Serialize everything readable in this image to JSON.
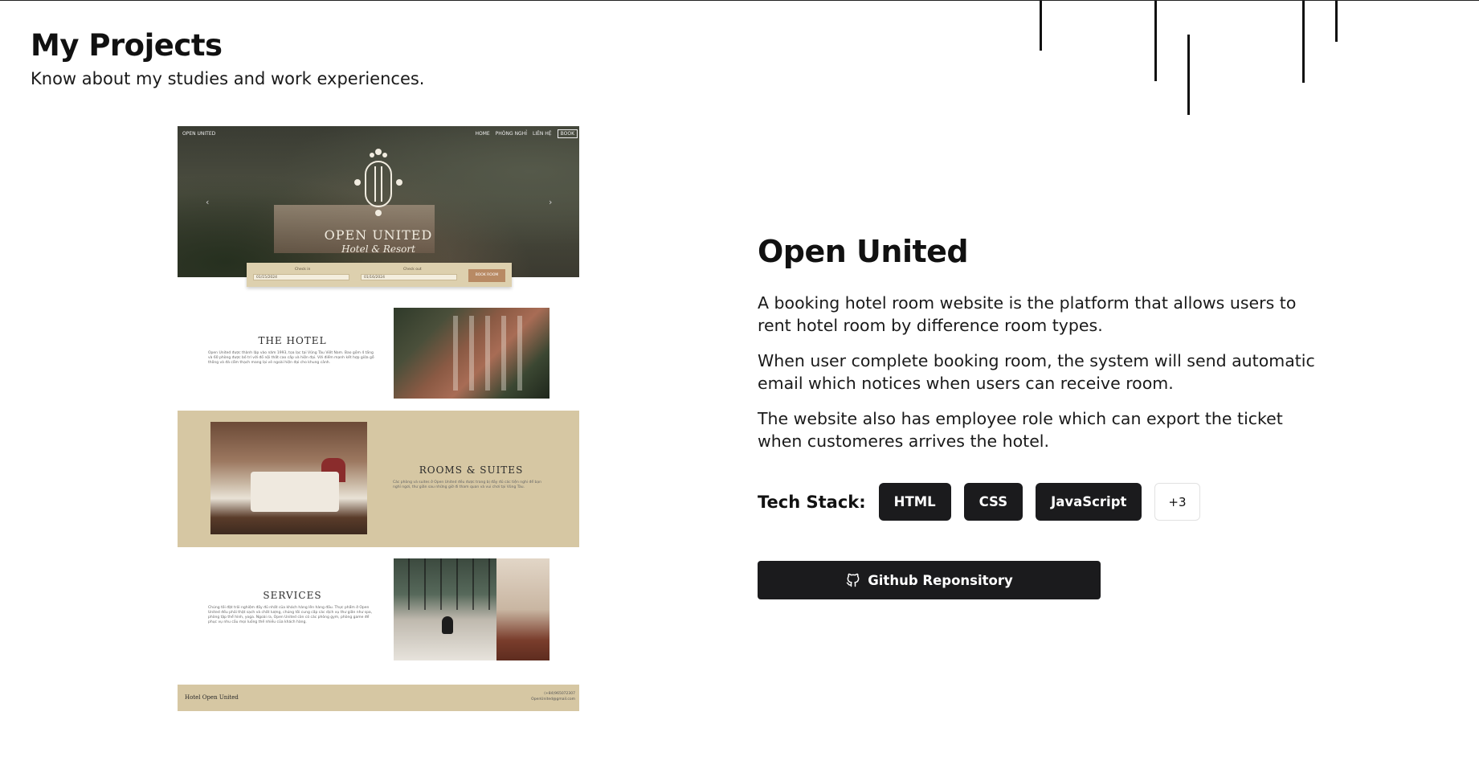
{
  "section": {
    "title": "My Projects",
    "subtitle": "Know about my studies and work experiences."
  },
  "preview": {
    "nav_brand": "OPEN UNITED",
    "nav_links": [
      "HOME",
      "PHÒNG NGHỈ",
      "LIÊN HỆ",
      "BOOK"
    ],
    "hero_title": "OPEN UNITED",
    "hero_subtitle": "Hotel & Resort",
    "checkin_label": "Check in",
    "checkin_value": "01/15/2024",
    "checkout_label": "Check out",
    "checkout_value": "01/16/2024",
    "book_button": "BOOK ROOM",
    "hotel_heading": "THE HOTEL",
    "hotel_text": "Open United được thành lập vào năm 1993, tọa lạc tại Vũng Tàu Việt Nam. Bao gồm 4 tầng và 60 phòng được bố trí với đồ nội thất cao cấp và hiện đại. Với điểm mạnh kết hợp giữa gỗ thông và đá cẩm thạch mang lại vẻ ngoài hiện đại cho khung cảnh.",
    "rooms_heading": "ROOMS & SUITES",
    "rooms_text": "Các phòng và suites ở Open United đều được trang bị đầy đủ các tiện nghi để bạn nghỉ ngơi, thư giãn sau những giờ đi tham quan và vui chơi tại Vũng Tàu.",
    "services_heading": "SERVICES",
    "services_text": "Chúng tôi đặt trải nghiệm đầy đủ nhất của khách hàng lên hàng đầu. Thực phẩm ở Open United đều phải thật sạch và chất lượng, chúng tôi cung cấp các dịch vụ thư giãn như spa, phòng tập thể hình, yoga. Ngoài ra, Open United còn có các phòng gym, phòng game để phục vụ nhu cầu mọi luồng thế nhiều của khách hàng.",
    "footer_name": "Hotel Open United",
    "footer_phone": "(+84)965072307",
    "footer_email": "OpenUnited@gmail.com"
  },
  "project": {
    "title": "Open United",
    "descriptions": [
      "A booking hotel room website is the platform that allows users to rent hotel room by difference room types.",
      "When user complete booking room, the system will send automatic email which notices when users can receive room.",
      "The website also has employee role which can export the ticket when customeres arrives the hotel."
    ],
    "tech_stack_label": "Tech Stack:",
    "tech_stack": [
      "HTML",
      "CSS",
      "JavaScript"
    ],
    "more_count": "+3",
    "github_button": "Github Reponsitory",
    "github_icon": "github-icon"
  },
  "colors": {
    "chip_bg": "#1b1b1d",
    "preview_beige": "#d6c7a3",
    "text": "#111111"
  }
}
